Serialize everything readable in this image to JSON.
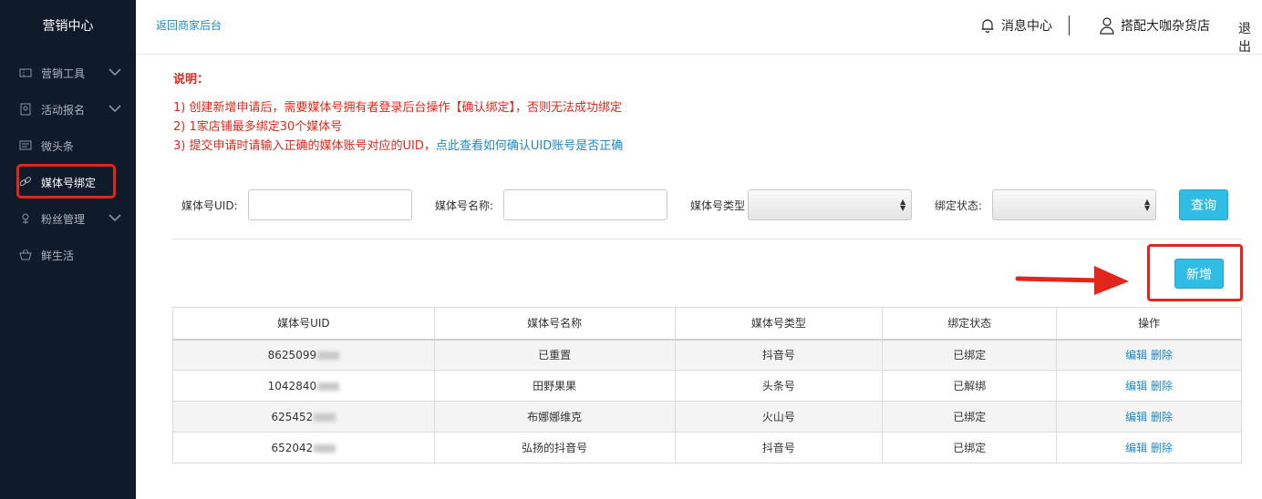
{
  "sidebar": {
    "title": "营销中心",
    "items": [
      {
        "label": "营销工具",
        "icon": "ticket-icon",
        "expandable": true
      },
      {
        "label": "活动报名",
        "icon": "badge-icon",
        "expandable": true
      },
      {
        "label": "微头条",
        "icon": "message-icon",
        "expandable": false
      },
      {
        "label": "媒体号绑定",
        "icon": "link-icon",
        "expandable": false,
        "active": true
      },
      {
        "label": "粉丝管理",
        "icon": "flower-icon",
        "expandable": true
      },
      {
        "label": "鲜生活",
        "icon": "basket-icon",
        "expandable": false
      }
    ]
  },
  "header": {
    "back_link": "返回商家后台",
    "messages": "消息中心",
    "store_name": "搭配大咖杂货店",
    "logout": "退出"
  },
  "notes": {
    "title": "说明：",
    "line1": "1) 创建新增申请后，需要媒体号拥有者登录后台操作【确认绑定】，否则无法成功绑定",
    "line2": "2) 1家店铺最多绑定30个媒体号",
    "line3": "3) 提交申请时请输入正确的媒体账号对应的UID，",
    "line3_link": "点此查看如何确认UID账号是否正确"
  },
  "filters": {
    "uid_label": "媒体号UID:",
    "name_label": "媒体号名称:",
    "type_label": "媒体号类型",
    "status_label": "绑定状态:",
    "query_button": "查询",
    "add_button": "新增"
  },
  "table": {
    "headers": [
      "媒体号UID",
      "媒体号名称",
      "媒体号类型",
      "绑定状态",
      "操作"
    ],
    "rows": [
      {
        "uid": "8625099",
        "name": "已重置",
        "type": "抖音号",
        "status": "已绑定"
      },
      {
        "uid": "1042840",
        "name": "田野果果",
        "type": "头条号",
        "status": "已解绑"
      },
      {
        "uid": "625452",
        "name": "布娜娜维克",
        "type": "火山号",
        "status": "已绑定"
      },
      {
        "uid": "652042",
        "name": "弘扬的抖音号",
        "type": "抖音号",
        "status": "已绑定"
      }
    ],
    "edit_label": "编辑",
    "delete_label": "删除"
  },
  "colors": {
    "sidebar_bg": "#0f1a2b",
    "accent_blue": "#2fbde6",
    "link_blue": "#1e88c8",
    "alert_red": "#e3261b"
  }
}
